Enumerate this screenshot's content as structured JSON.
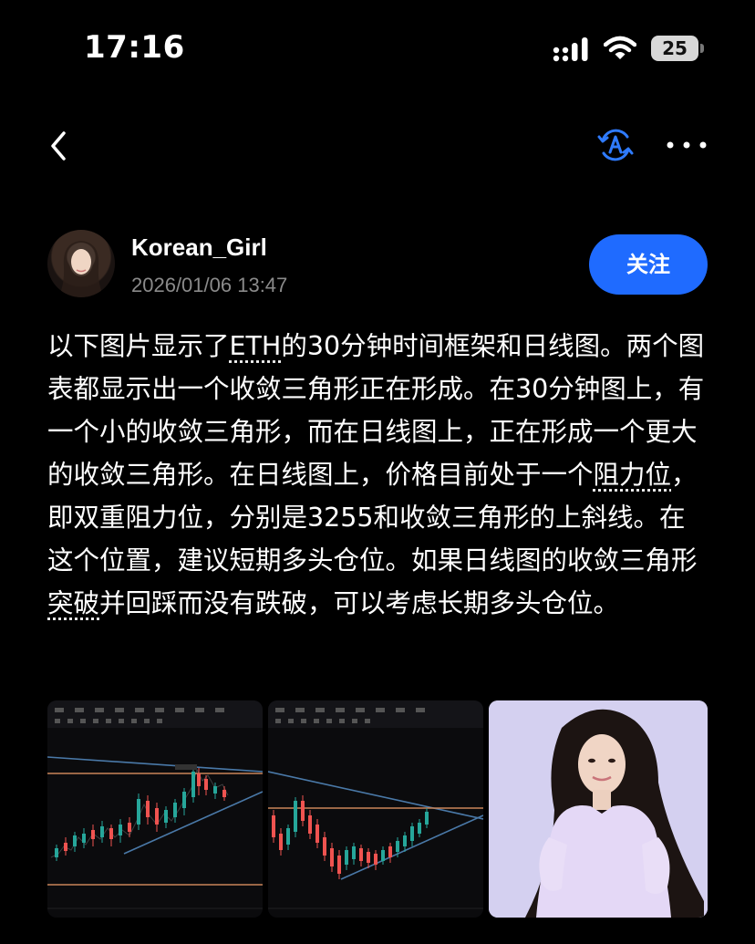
{
  "status_bar": {
    "time": "17:16",
    "battery": "25"
  },
  "nav": {
    "back_icon": "chevron-left-icon",
    "translate_icon": "translate-icon",
    "more_icon": "more-icon"
  },
  "author": {
    "username": "Korean_Girl",
    "date": "2026/01/06 13:47",
    "follow_label": "关注"
  },
  "post": {
    "segments": [
      "以下图片显示了",
      "ETH",
      "的30分钟时间框架和日线图。两个图表都显示出一个收敛三角形正在形成。在30分钟图上，有一个小的收敛三角形，而在日线图上，正在形成一个更大的收敛三角形。在日线图上，价格目前处于一个",
      "阻力位",
      "，即双重阻力位，分别是3255和收敛三角形的上斜线。在这个位置，建议短期多头仓位。如果日线图的收敛三角形",
      "突破",
      "并回踩而没有跌破，可以考虑长期多头仓位。"
    ]
  },
  "images": {
    "chart_30m_alt": "ETH 30-minute chart",
    "chart_daily_alt": "ETH daily chart",
    "photo_alt": "photo"
  },
  "colors": {
    "accent": "#1f6bff",
    "background": "#000000",
    "secondary_text": "#8a8a8a"
  }
}
